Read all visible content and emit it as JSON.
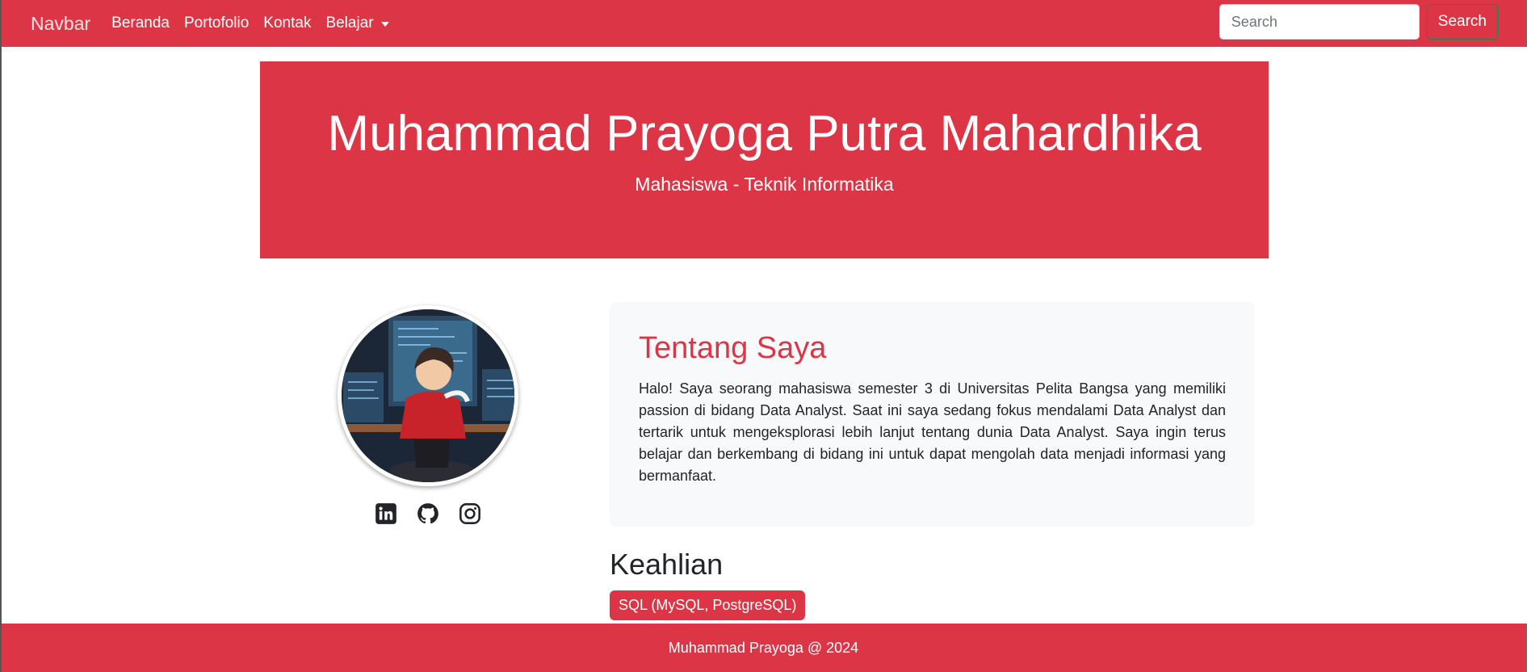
{
  "navbar": {
    "brand": "Navbar",
    "links": [
      "Beranda",
      "Portofolio",
      "Kontak"
    ],
    "dropdown_label": "Belajar",
    "search_placeholder": "Search",
    "search_button": "Search"
  },
  "hero": {
    "name": "Muhammad Prayoga Putra Mahardhika",
    "subtitle": "Mahasiswa - Teknik Informatika"
  },
  "profile": {
    "socials": [
      "linkedin-icon",
      "github-icon",
      "instagram-icon"
    ]
  },
  "about": {
    "title": "Tentang Saya",
    "text": "Halo! Saya seorang mahasiswa semester 3 di Universitas Pelita Bangsa yang memiliki passion di bidang Data Analyst. Saat ini saya sedang fokus mendalami Data Analyst dan tertarik untuk mengeksplorasi lebih lanjut tentang dunia Data Analyst. Saya ingin terus belajar dan berkembang di bidang ini untuk dapat mengolah data menjadi informasi yang bermanfaat."
  },
  "skills": {
    "title": "Keahlian",
    "items": [
      "SQL (MySQL, PostgreSQL)"
    ]
  },
  "footer": {
    "text": "Muhammad Prayoga @ 2024"
  },
  "colors": {
    "primary": "#dc3545",
    "card_bg": "#f8f9fa"
  }
}
